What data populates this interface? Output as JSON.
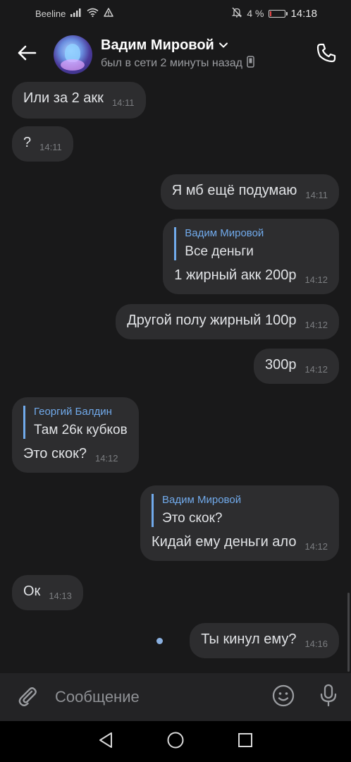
{
  "status_bar": {
    "carrier": "Beeline",
    "battery_percent": "4 %",
    "time": "14:18",
    "icons": [
      "signal-icon",
      "wifi-icon",
      "warning-icon",
      "mute-icon",
      "battery-icon"
    ]
  },
  "header": {
    "name": "Вадим Мировой",
    "status": "был в сети 2 минуты назад",
    "icons": [
      "back-arrow-icon",
      "chevron-down-icon",
      "phone-device-icon",
      "phone-call-icon"
    ]
  },
  "messages": [
    {
      "direction": "in",
      "text": "Или за 2 акк",
      "time": "14:11"
    },
    {
      "direction": "in",
      "text": "?",
      "time": "14:11"
    },
    {
      "direction": "out",
      "text": "Я мб ещё подумаю",
      "time": "14:11"
    },
    {
      "direction": "out",
      "reply_author": "Вадим Мировой",
      "reply_text": "Все деньги",
      "text": "1 жирный акк 200р",
      "time": "14:12"
    },
    {
      "direction": "out",
      "text": "Другой полу жирный 100р",
      "time": "14:12"
    },
    {
      "direction": "out",
      "text": "300р",
      "time": "14:12"
    },
    {
      "direction": "in",
      "reply_author": "Георгий Балдин",
      "reply_text": "Там 26к кубков",
      "text": "Это скок?",
      "time": "14:12"
    },
    {
      "direction": "out",
      "reply_author": "Вадим Мировой",
      "reply_text": "Это скок?",
      "text": "Кидай ему деньги ало",
      "time": "14:12"
    },
    {
      "direction": "in",
      "text": "Ок",
      "time": "14:13"
    },
    {
      "direction": "out",
      "text": "Ты кинул ему?",
      "time": "14:16",
      "unread": true
    }
  ],
  "composer": {
    "placeholder": "Сообщение",
    "icons": [
      "attach-paperclip-icon",
      "emoji-icon",
      "microphone-icon"
    ]
  },
  "nav_bar": {
    "icons": [
      "nav-back-icon",
      "nav-home-icon",
      "nav-recents-icon"
    ]
  },
  "colors": {
    "background": "#19191a",
    "bubble": "#2d2d2f",
    "accent": "#71aaeb",
    "text": "#e1e3e6",
    "muted": "#7b7d80"
  }
}
